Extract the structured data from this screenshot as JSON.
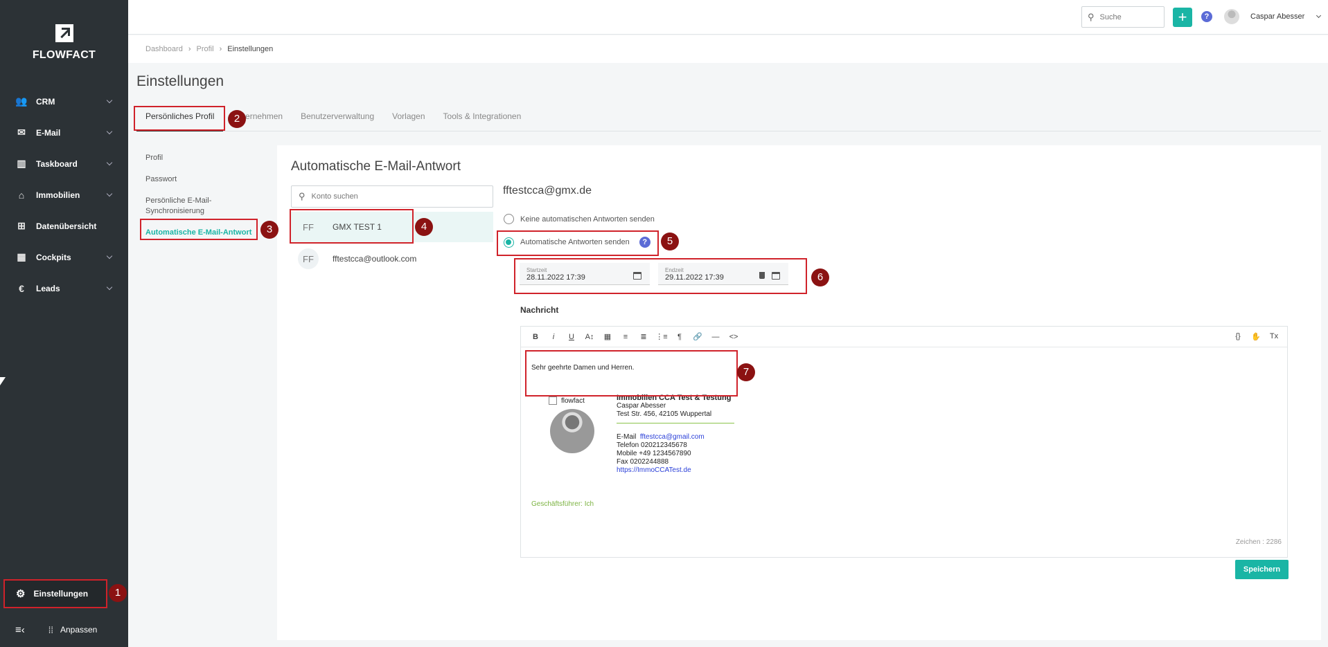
{
  "brand": {
    "name": "FLOWFACT",
    "accent": "#1ab5a5",
    "sidebar_bg": "#2c3236",
    "highlight": "#d0222a",
    "badge": "#8b1212"
  },
  "sidebar": {
    "items": [
      {
        "label": "CRM",
        "icon": "users-icon"
      },
      {
        "label": "E-Mail",
        "icon": "mail-icon"
      },
      {
        "label": "Taskboard",
        "icon": "columns-icon"
      },
      {
        "label": "Immobilien",
        "icon": "home-icon"
      },
      {
        "label": "Datenübersicht",
        "icon": "grid-icon"
      },
      {
        "label": "Cockpits",
        "icon": "dashboard-icon"
      },
      {
        "label": "Leads",
        "icon": "euro-icon"
      }
    ],
    "settings_label": "Einstellungen",
    "customize_label": "Anpassen"
  },
  "topbar": {
    "search_placeholder": "Suche",
    "plus": "+",
    "help": "?",
    "user_name": "Caspar Abesser"
  },
  "breadcrumb": [
    "Dashboard",
    "Profil",
    "Einstellungen"
  ],
  "page_title": "Einstellungen",
  "tabs": [
    "Persönliches Profil",
    "Unternehmen",
    "Benutzerverwaltung",
    "Vorlagen",
    "Tools & Integrationen"
  ],
  "subnav": [
    "Profil",
    "Passwort",
    "Persönliche E-Mail-Synchronisierung",
    "Automatische E-Mail-Antwort"
  ],
  "panel": {
    "title": "Automatische E-Mail-Antwort",
    "search_placeholder": "Konto suchen",
    "accounts": [
      {
        "initials": "FF",
        "name": "GMX TEST 1"
      },
      {
        "initials": "FF",
        "name": "fftestcca@outlook.com"
      }
    ],
    "account_email": "fftestcca@gmx.de",
    "radio_off": "Keine automatischen Antworten senden",
    "radio_on": "Automatische Antworten senden",
    "start_label": "Startzeit",
    "start_value": "28.11.2022 17:39",
    "end_label": "Endzeit",
    "end_value": "29.11.2022 17:39",
    "message_label": "Nachricht",
    "toolbar": [
      "B",
      "i",
      "U",
      "A↕",
      "▦",
      "≡",
      "≣",
      "⋮≡",
      "¶",
      "🔗",
      "—",
      "<>"
    ],
    "toolbar_right": [
      "{}",
      "✋",
      "Tx"
    ],
    "greeting": "Sehr geehrte Damen und Herren.",
    "sig_logo": "flowfact",
    "sig_company": "Immobilien CCA Test & Testung",
    "sig_name": "Caspar Abesser",
    "sig_address": "Test Str. 456, 42105 Wuppertal",
    "sig_email_label": "E-Mail",
    "sig_email": "fftestcca@gmail.com",
    "sig_phone": "Telefon 020212345678",
    "sig_mobile": "Mobile +49 1234567890",
    "sig_fax": "Fax 0202244888",
    "sig_web": "https://ImmoCCATest.de",
    "footer_note": "Geschäftsführer: Ich",
    "char_count": "Zeichen : 2286",
    "save_label": "Speichern"
  },
  "callouts": [
    "1",
    "2",
    "3",
    "4",
    "5",
    "6",
    "7"
  ]
}
